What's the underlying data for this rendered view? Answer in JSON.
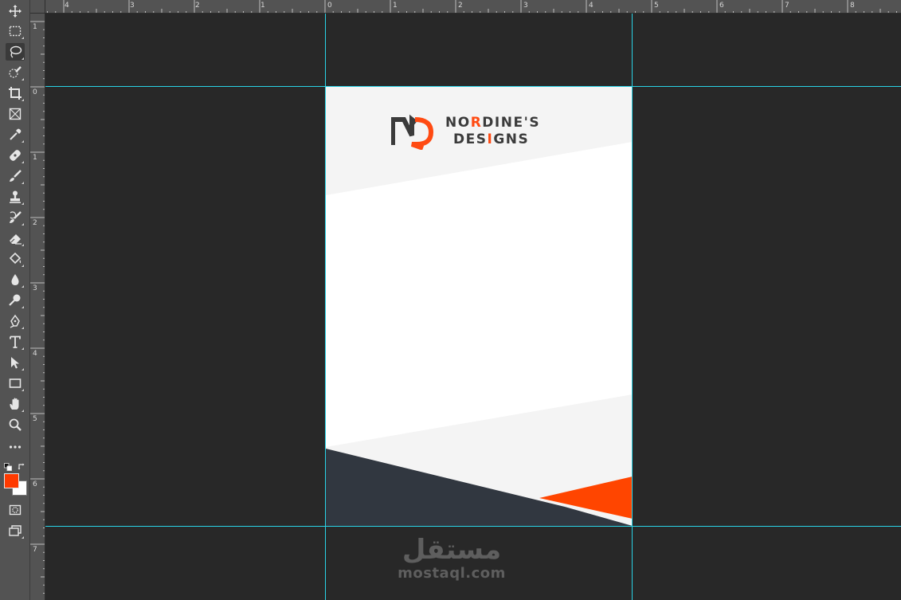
{
  "toolbar": {
    "tools": [
      {
        "name": "move-tool",
        "icon": "move-icon"
      },
      {
        "name": "marquee-tool",
        "icon": "rectangular-marquee-icon"
      },
      {
        "name": "lasso-tool",
        "icon": "lasso-icon",
        "active": true
      },
      {
        "name": "quick-selection-tool",
        "icon": "quick-selection-icon"
      },
      {
        "name": "crop-tool",
        "icon": "crop-icon"
      },
      {
        "name": "frame-tool",
        "icon": "frame-icon"
      },
      {
        "name": "eyedropper-tool",
        "icon": "eyedropper-icon"
      },
      {
        "name": "healing-brush-tool",
        "icon": "bandage-icon"
      },
      {
        "name": "brush-tool",
        "icon": "brush-icon"
      },
      {
        "name": "clone-stamp-tool",
        "icon": "stamp-icon"
      },
      {
        "name": "history-brush-tool",
        "icon": "history-brush-icon"
      },
      {
        "name": "eraser-tool",
        "icon": "eraser-icon"
      },
      {
        "name": "paint-bucket-tool",
        "icon": "paint-bucket-icon"
      },
      {
        "name": "blur-tool",
        "icon": "drop-icon"
      },
      {
        "name": "dodge-tool",
        "icon": "dodge-icon"
      },
      {
        "name": "pen-tool",
        "icon": "pen-icon"
      },
      {
        "name": "type-tool",
        "icon": "type-icon"
      },
      {
        "name": "path-selection-tool",
        "icon": "arrow-icon"
      },
      {
        "name": "rectangle-tool",
        "icon": "rectangle-icon"
      },
      {
        "name": "hand-tool",
        "icon": "hand-icon"
      },
      {
        "name": "zoom-tool",
        "icon": "magnifier-icon"
      },
      {
        "name": "more-tools",
        "icon": "ellipsis-icon"
      }
    ],
    "foreground_color": "#ff3a00",
    "background_color": "#ffffff"
  },
  "rulers": {
    "top_labels": [
      "4",
      "3",
      "2",
      "1",
      "0",
      "1",
      "2",
      "3",
      "4",
      "5",
      "6",
      "7",
      "8"
    ],
    "left_labels": [
      "1",
      "0",
      "1",
      "2",
      "3",
      "4",
      "5",
      "6",
      "7"
    ]
  },
  "document": {
    "logo": {
      "line1": "NORDINE'S",
      "line2": "DESIGNS",
      "accent_color": "#ff4a12",
      "text_color": "#3b3b3b"
    },
    "colors": {
      "light_band": "#f4f4f4",
      "dark_band": "#313740",
      "orange_band": "#ff4500"
    }
  },
  "guides": {
    "color": "#29d3e6"
  },
  "watermark": {
    "arabic": "مستقل",
    "latin": "mostaql.com"
  }
}
